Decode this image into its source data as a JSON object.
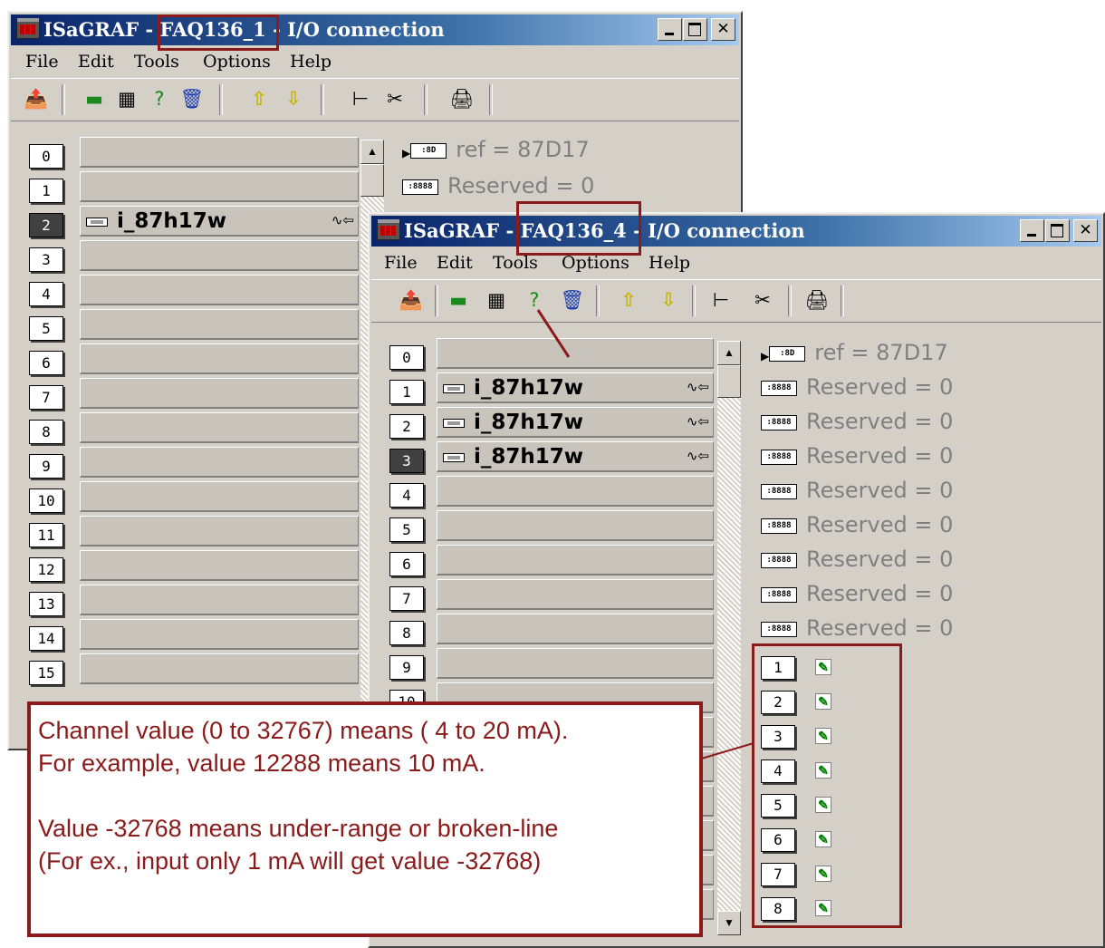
{
  "window1": {
    "app_name": "ISaGRAF",
    "project": "FAQ136_1",
    "title_suffix": "I/O connection",
    "slots": [
      "0",
      "1",
      "2",
      "3",
      "4",
      "5",
      "6",
      "7",
      "8",
      "9",
      "10",
      "11",
      "12",
      "13",
      "14",
      "15"
    ],
    "selected_slot": "2",
    "board_name": "i_87h17w",
    "board_symbols": "∿⇦",
    "param_ref": "ref = 87D17",
    "param_reserved": "Reserved = 0"
  },
  "window2": {
    "app_name": "ISaGRAF",
    "project": "FAQ136_4",
    "title_suffix": "I/O connection",
    "slots": [
      "0",
      "1",
      "2",
      "3",
      "4",
      "5",
      "6",
      "7",
      "8",
      "9",
      "10"
    ],
    "selected_slot": "3",
    "board_name": "i_87h17w",
    "board_symbols": "∿⇦",
    "param_ref": "ref = 87D17",
    "param_reserved": "Reserved = 0",
    "channels": [
      "1",
      "2",
      "3",
      "4",
      "5",
      "6",
      "7",
      "8"
    ]
  },
  "menu": {
    "file": "File",
    "edit": "Edit",
    "tools": "Tools",
    "options": "Options",
    "help": "Help"
  },
  "title_separator": "-",
  "param_icon_ref": ":8D",
  "param_icon_res": ":8888",
  "annotation": {
    "line1": "Channel value (0 to 32767) means ( 4 to 20 mA).",
    "line2": "For example, value 12288 means 10 mA.",
    "line3": "Value -32768 means under-range or broken-line",
    "line4": "(For ex., input only 1 mA will get value -32768)"
  },
  "colors": {
    "highlight": "#8b1a1a",
    "titlebar": "#0a246a",
    "window_bg": "#d4d0c8"
  }
}
